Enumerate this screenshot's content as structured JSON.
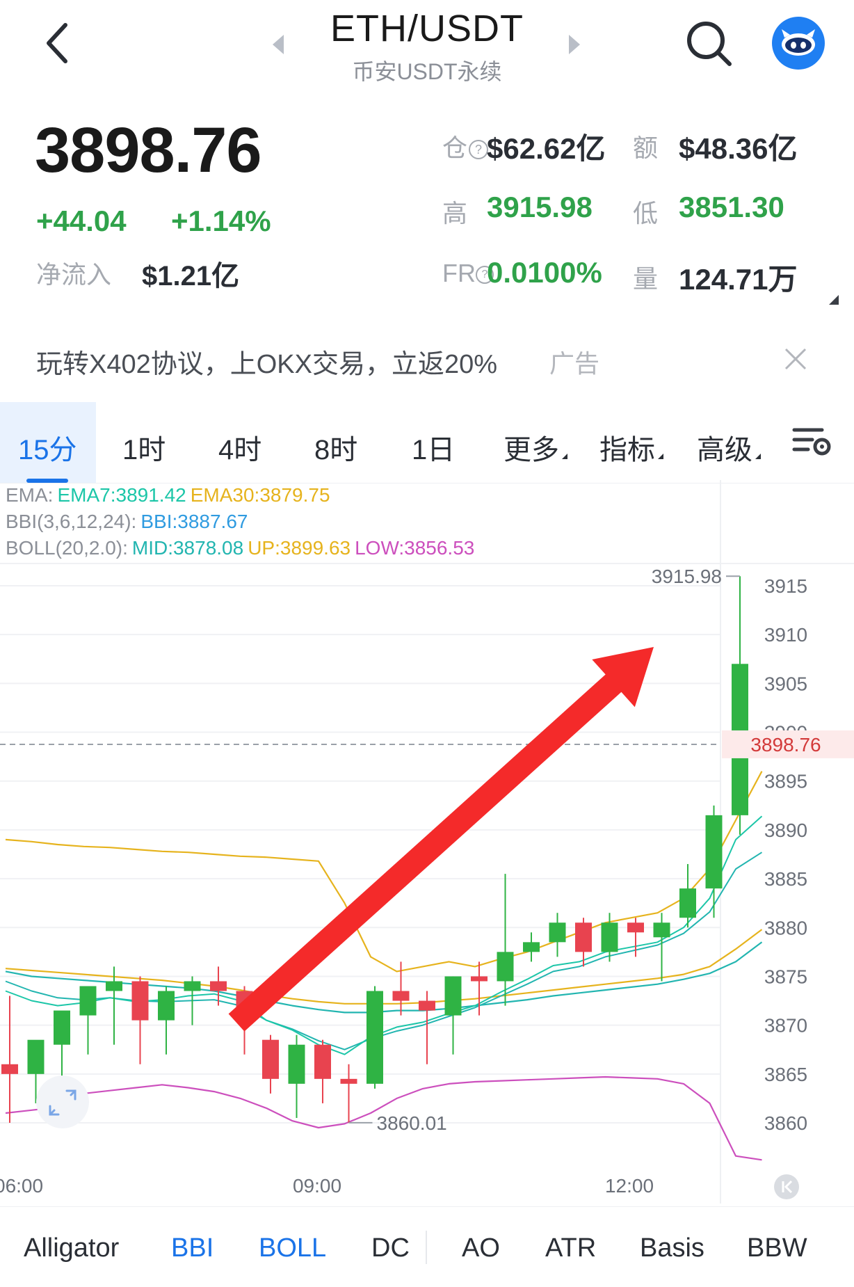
{
  "header": {
    "title": "ETH/USDT",
    "subtitle": "币安USDT永续"
  },
  "price": {
    "last": "3898.76",
    "change": "+44.04",
    "change_pct": "+1.14%",
    "net_inflow_label": "净流入",
    "net_inflow_value": "$1.21亿"
  },
  "stats": {
    "oi_label": "仓",
    "oi_value": "$62.62亿",
    "amount_label": "额",
    "amount_value": "$48.36亿",
    "high_label": "高",
    "high_value": "3915.98",
    "low_label": "低",
    "low_value": "3851.30",
    "fr_label": "FR",
    "fr_value": "0.0100%",
    "volume_label": "量",
    "volume_value": "124.71万"
  },
  "ad": {
    "text": "玩转X402协议，上OKX交易，立返20%",
    "tag": "广告"
  },
  "timeframes": {
    "items": [
      "15分",
      "1时",
      "4时",
      "8时",
      "1日"
    ],
    "active": "15分",
    "more": "更多",
    "indicators": "指标",
    "advanced": "高级"
  },
  "legends": {
    "ema_label": "EMA:",
    "ema7": "EMA7:3891.42",
    "ema30": "EMA30:3879.75",
    "bbi_label": "BBI(3,6,12,24):",
    "bbi": "BBI:3887.67",
    "boll_label": "BOLL(20,2.0):",
    "boll_mid": "MID:3878.08",
    "boll_up": "UP:3899.63",
    "boll_low": "LOW:3856.53"
  },
  "colors": {
    "up": "#2fb344",
    "down": "#e8434f",
    "ema7": "#1cc6a8",
    "ema30": "#e6b31d",
    "bbi": "#2f9be0",
    "boll_mid": "#22b5b0",
    "boll_up": "#e6b31d",
    "boll_low": "#cc4fbd",
    "arrow": "#f42a2a",
    "accent": "#1a73e8"
  },
  "chart_data": {
    "type": "candlestick",
    "price_axis": [
      "3915",
      "3910",
      "3905",
      "3900",
      "3895",
      "3890",
      "3885",
      "3880",
      "3875",
      "3870",
      "3865",
      "3860"
    ],
    "time_axis": [
      "06:00",
      "09:00",
      "12:00"
    ],
    "current_price_label": "3898.76",
    "high_marker": "3915.98",
    "low_marker": "3860.01",
    "candles": [
      {
        "o": 3866.0,
        "h": 3873.0,
        "l": 3860.0,
        "c": 3865.0
      },
      {
        "o": 3865.0,
        "h": 3868.0,
        "l": 3862.0,
        "c": 3868.5
      },
      {
        "o": 3868.0,
        "h": 3871.0,
        "l": 3863.0,
        "c": 3871.5
      },
      {
        "o": 3871.0,
        "h": 3874.0,
        "l": 3867.0,
        "c": 3874.0
      },
      {
        "o": 3873.5,
        "h": 3876.0,
        "l": 3868.0,
        "c": 3874.5
      },
      {
        "o": 3874.5,
        "h": 3875.0,
        "l": 3866.0,
        "c": 3870.5
      },
      {
        "o": 3870.5,
        "h": 3874.0,
        "l": 3867.0,
        "c": 3873.5
      },
      {
        "o": 3873.5,
        "h": 3875.0,
        "l": 3870.0,
        "c": 3874.5
      },
      {
        "o": 3874.5,
        "h": 3876.0,
        "l": 3872.0,
        "c": 3873.5
      },
      {
        "o": 3873.5,
        "h": 3874.0,
        "l": 3867.0,
        "c": 3870.5
      },
      {
        "o": 3868.5,
        "h": 3869.0,
        "l": 3863.0,
        "c": 3864.5
      },
      {
        "o": 3864.0,
        "h": 3869.0,
        "l": 3860.5,
        "c": 3868.0
      },
      {
        "o": 3868.0,
        "h": 3868.5,
        "l": 3862.0,
        "c": 3864.5
      },
      {
        "o": 3864.5,
        "h": 3866.0,
        "l": 3860.01,
        "c": 3864.0
      },
      {
        "o": 3864.0,
        "h": 3874.0,
        "l": 3863.5,
        "c": 3873.5
      },
      {
        "o": 3873.5,
        "h": 3876.5,
        "l": 3871.0,
        "c": 3872.5
      },
      {
        "o": 3872.5,
        "h": 3873.5,
        "l": 3866.0,
        "c": 3871.5
      },
      {
        "o": 3871.0,
        "h": 3875.0,
        "l": 3867.0,
        "c": 3875.0
      },
      {
        "o": 3875.0,
        "h": 3876.5,
        "l": 3871.0,
        "c": 3874.5
      },
      {
        "o": 3874.5,
        "h": 3885.5,
        "l": 3872.0,
        "c": 3877.5
      },
      {
        "o": 3877.5,
        "h": 3879.5,
        "l": 3876.5,
        "c": 3878.5
      },
      {
        "o": 3878.5,
        "h": 3881.5,
        "l": 3877.0,
        "c": 3880.5
      },
      {
        "o": 3880.5,
        "h": 3881.0,
        "l": 3876.0,
        "c": 3877.5
      },
      {
        "o": 3877.5,
        "h": 3881.5,
        "l": 3876.5,
        "c": 3880.5
      },
      {
        "o": 3880.5,
        "h": 3881.0,
        "l": 3877.0,
        "c": 3879.5
      },
      {
        "o": 3879.0,
        "h": 3881.5,
        "l": 3874.5,
        "c": 3880.5
      },
      {
        "o": 3881.0,
        "h": 3886.5,
        "l": 3880.0,
        "c": 3884.0
      },
      {
        "o": 3884.0,
        "h": 3892.5,
        "l": 3881.0,
        "c": 3891.5
      },
      {
        "o": 3891.5,
        "h": 3915.98,
        "l": 3889.5,
        "c": 3907.0
      }
    ],
    "boll_up": [
      3889.0,
      3888.8,
      3888.5,
      3888.3,
      3888.2,
      3888.0,
      3887.8,
      3887.7,
      3887.5,
      3887.3,
      3887.2,
      3887.0,
      3886.8,
      3882.5,
      3877.0,
      3875.5,
      3876.0,
      3876.5,
      3876.0,
      3876.8,
      3877.5,
      3878.5,
      3879.5,
      3880.5,
      3881.0,
      3881.5,
      3883.0,
      3886.0,
      3891.0,
      3896.0
    ],
    "boll_mid": [
      3875.5,
      3875.0,
      3874.8,
      3874.6,
      3874.4,
      3874.2,
      3874.0,
      3873.8,
      3873.5,
      3873.0,
      3872.5,
      3872.0,
      3871.6,
      3871.3,
      3871.3,
      3871.5,
      3871.5,
      3871.7,
      3872.0,
      3872.3,
      3872.6,
      3873.0,
      3873.3,
      3873.6,
      3873.9,
      3874.2,
      3874.7,
      3875.3,
      3876.5,
      3878.5
    ],
    "boll_low": [
      3861.0,
      3861.3,
      3861.6,
      3863.0,
      3863.3,
      3863.6,
      3863.9,
      3863.6,
      3863.2,
      3862.5,
      3861.5,
      3860.2,
      3859.5,
      3859.9,
      3861.0,
      3862.5,
      3863.5,
      3864.0,
      3864.2,
      3864.3,
      3864.4,
      3864.5,
      3864.6,
      3864.7,
      3864.6,
      3864.5,
      3864.0,
      3862.0,
      3856.6,
      3856.2
    ],
    "ema7": [
      3873.5,
      3872.5,
      3872.0,
      3872.3,
      3872.8,
      3872.4,
      3872.6,
      3873.0,
      3873.2,
      3872.5,
      3870.5,
      3869.5,
      3868.0,
      3867.0,
      3868.8,
      3869.8,
      3870.3,
      3871.2,
      3872.0,
      3873.4,
      3874.7,
      3876.1,
      3876.5,
      3877.5,
      3878.0,
      3878.5,
      3880.0,
      3883.0,
      3889.0,
      3891.4
    ],
    "ema30": [
      3875.8,
      3875.6,
      3875.4,
      3875.2,
      3875.0,
      3874.8,
      3874.6,
      3874.3,
      3874.0,
      3873.6,
      3873.1,
      3872.7,
      3872.4,
      3872.2,
      3872.2,
      3872.2,
      3872.3,
      3872.5,
      3872.7,
      3873.0,
      3873.3,
      3873.6,
      3873.9,
      3874.2,
      3874.5,
      3874.8,
      3875.2,
      3876.0,
      3877.8,
      3879.8
    ],
    "bbi": [
      3874.5,
      3873.5,
      3872.8,
      3872.6,
      3872.8,
      3872.5,
      3872.4,
      3872.5,
      3872.6,
      3872.0,
      3870.5,
      3869.6,
      3868.4,
      3867.5,
      3868.6,
      3869.4,
      3870.0,
      3870.9,
      3871.8,
      3873.0,
      3874.2,
      3875.5,
      3876.0,
      3877.0,
      3877.6,
      3878.2,
      3879.4,
      3881.6,
      3886.0,
      3887.7
    ]
  },
  "indicators": {
    "items": [
      "Alligator",
      "BBI",
      "BOLL",
      "DC",
      "AO",
      "ATR",
      "Basis",
      "BBW"
    ],
    "active": [
      "BBI",
      "BOLL"
    ]
  }
}
